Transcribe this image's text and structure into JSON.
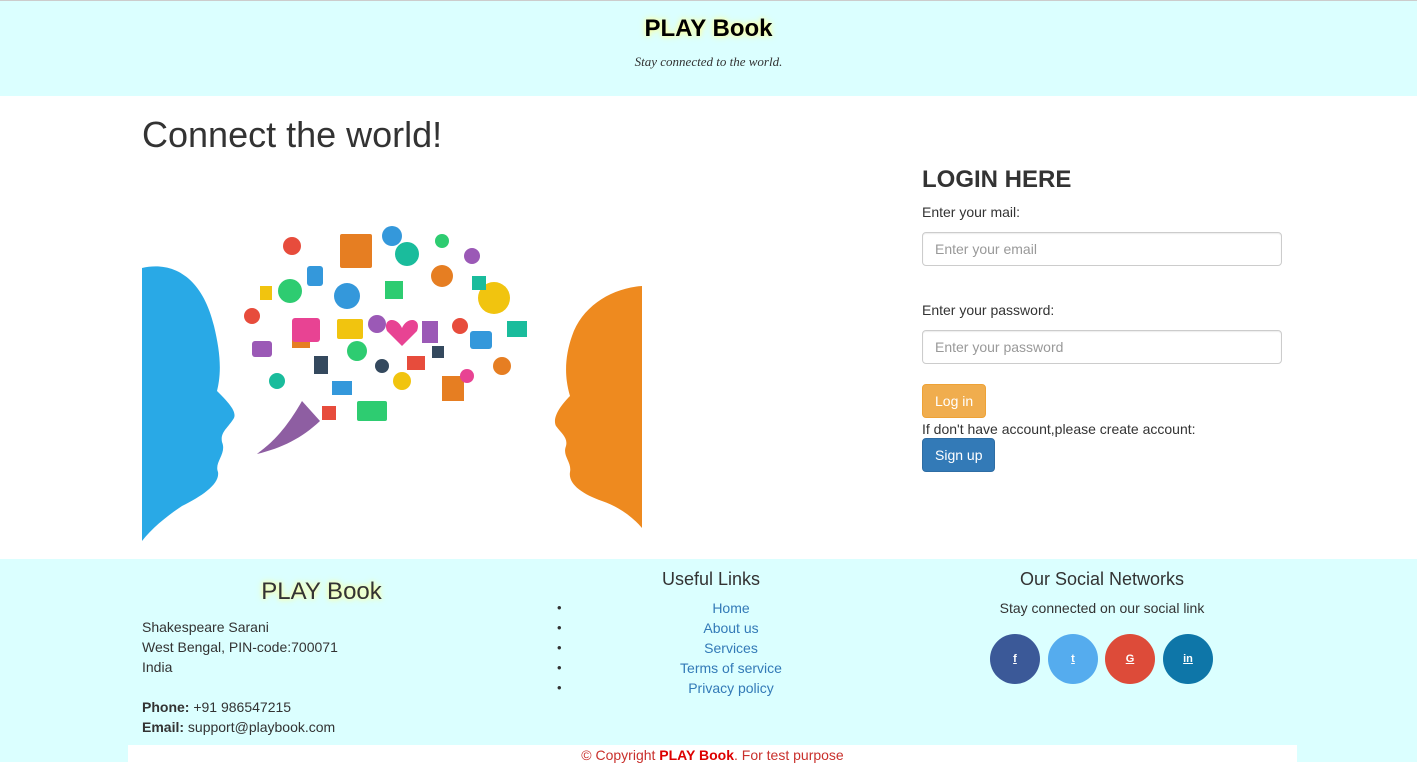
{
  "header": {
    "brand": "PLAY Book",
    "tagline": "Stay connected to the world."
  },
  "main": {
    "headline": "Connect the world!",
    "illustration_icon": "speech-bubble-icons-illustration"
  },
  "login": {
    "title": "LOGIN HERE",
    "email_label": "Enter your mail:",
    "email_placeholder": "Enter your email",
    "email_value": "",
    "password_label": "Enter your password:",
    "password_placeholder": "Enter your password",
    "password_value": "",
    "login_button": "Log in",
    "note": "If don't have account,please create account:",
    "signup_button": "Sign up",
    "colors": {
      "login": "#f0ad4e",
      "signup": "#337ab7"
    }
  },
  "footer": {
    "brand": "PLAY Book",
    "address_line1": "Shakespeare Sarani",
    "address_line2": "West Bengal, PIN-code:700071",
    "address_line3": "India",
    "phone_label": "Phone:",
    "phone": "+91 986547215",
    "email_label": "Email:",
    "email": "support@playbook.com",
    "links_title": "Useful Links",
    "links": [
      "Home",
      "About us",
      "Services",
      "Terms of service",
      "Privacy policy"
    ],
    "social_title": "Our Social Networks",
    "social_subtitle": "Stay connected on our social link",
    "social": [
      {
        "label": "f",
        "icon": "facebook-icon",
        "color": "#3b5998"
      },
      {
        "label": "t",
        "icon": "twitter-icon",
        "color": "#55acee"
      },
      {
        "label": "G",
        "icon": "google-plus-icon",
        "color": "#dd4b39"
      },
      {
        "label": "in",
        "icon": "linkedin-icon",
        "color": "#0e76a8"
      }
    ],
    "copyright_prefix": "© Copyright ",
    "copyright_brand": "PLAY Book",
    "copyright_suffix": ". For test purpose"
  }
}
